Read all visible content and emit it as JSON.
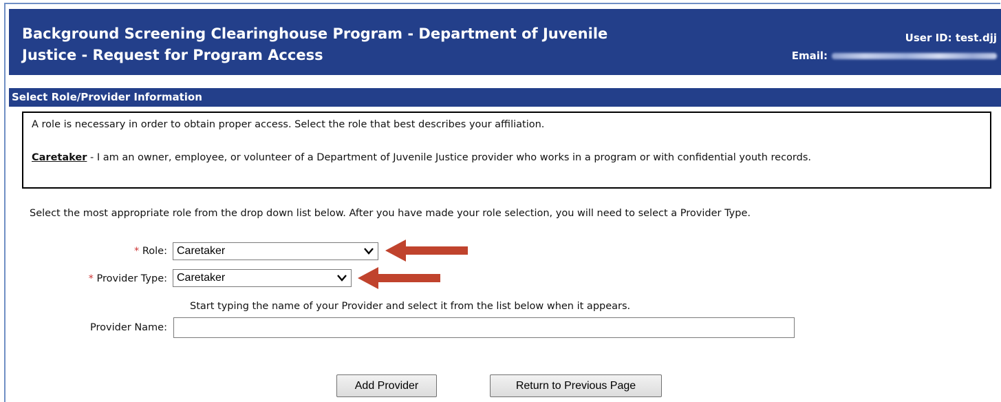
{
  "header": {
    "title": "Background Screening Clearinghouse Program - Department of Juvenile Justice - Request for Program Access",
    "user_id": "User ID: test.djj",
    "email_label": "Email:"
  },
  "section": {
    "title": "Select Role/Provider Information"
  },
  "info": {
    "intro": "A role is necessary in order to obtain proper access. Select the role that best describes your affiliation.",
    "caretaker_term": "Caretaker",
    "caretaker_desc": " - I am an owner, employee, or volunteer of a Department of Juvenile Justice provider who works in a program or with confidential youth records."
  },
  "instruction": "Select the most appropriate role from the drop down list below. After you have made your role selection, you will need to select a Provider Type.",
  "form": {
    "required_mark": "*",
    "role_label": "Role:",
    "role_value": "Caretaker",
    "provider_type_label": "Provider Type:",
    "provider_type_value": "Caretaker",
    "hint": "Start typing the name of your Provider and select it from the list below when it appears.",
    "provider_name_label": "Provider Name:",
    "provider_name_value": ""
  },
  "buttons": {
    "add_provider": "Add Provider",
    "return": "Return to Previous Page"
  },
  "colors": {
    "header_bg": "#233f8a",
    "arrow": "#c0432d",
    "required": "#cc3333"
  },
  "icons": {
    "dropdown": "chevron-down-icon",
    "arrow": "arrow-left-icon"
  }
}
